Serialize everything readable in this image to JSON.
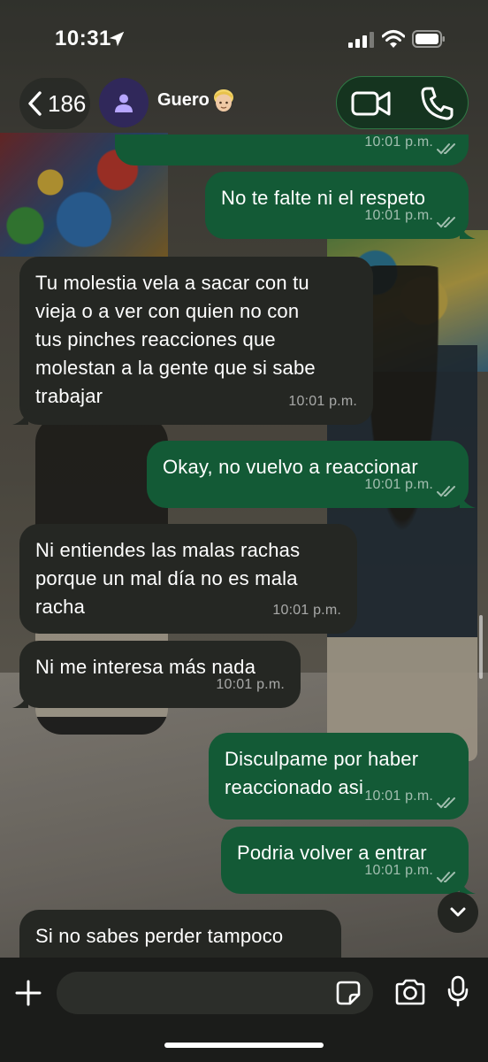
{
  "status_bar": {
    "time": "10:31",
    "icons": [
      "location-arrow-icon",
      "cellular-signal-icon",
      "wifi-icon",
      "battery-icon"
    ]
  },
  "header": {
    "back_count": "186",
    "contact_name": "Guero",
    "contact_emoji": "👱🏼",
    "icons": [
      "chevron-left-icon",
      "person-icon",
      "video-call-icon",
      "phone-icon"
    ]
  },
  "messages": [
    {
      "direction": "out",
      "text": "",
      "time": "10:01 p.m.",
      "read": true
    },
    {
      "direction": "out",
      "text": "No te falte ni el respeto",
      "time": "10:01 p.m.",
      "read": true
    },
    {
      "direction": "in",
      "text": "Tu molestia vela a sacar con tu\nvieja o a ver con quien no con\ntus pinches reacciones que\nmolestan a la gente que si sabe\ntrabajar",
      "time": "10:01 p.m."
    },
    {
      "direction": "out",
      "text": "Okay, no vuelvo a reaccionar",
      "time": "10:01 p.m.",
      "read": true
    },
    {
      "direction": "in",
      "text": "Ni entiendes las malas rachas\nporque un mal día no es mala\nracha",
      "time": "10:01 p.m."
    },
    {
      "direction": "in",
      "text": "Ni me interesa más nada",
      "time": "10:01 p.m."
    },
    {
      "direction": "out",
      "text": "Disculpame por haber\nreaccionado asi",
      "time": "10:01 p.m.",
      "read": true
    },
    {
      "direction": "out",
      "text": "Podria volver a entrar",
      "time": "10:01 p.m.",
      "read": true
    },
    {
      "direction": "in",
      "text": "Si no sabes perder tampoco\nmereces ganar",
      "time": ""
    }
  ],
  "composer": {
    "placeholder": "",
    "icons": [
      "plus-icon",
      "sticker-icon",
      "camera-icon",
      "microphone-icon",
      "chevron-down-icon"
    ]
  },
  "colors": {
    "outgoing_bubble": "#135a36",
    "incoming_bubble": "#252723",
    "call_group_border": "#2f7a45",
    "avatar_bg": "#30285a"
  }
}
